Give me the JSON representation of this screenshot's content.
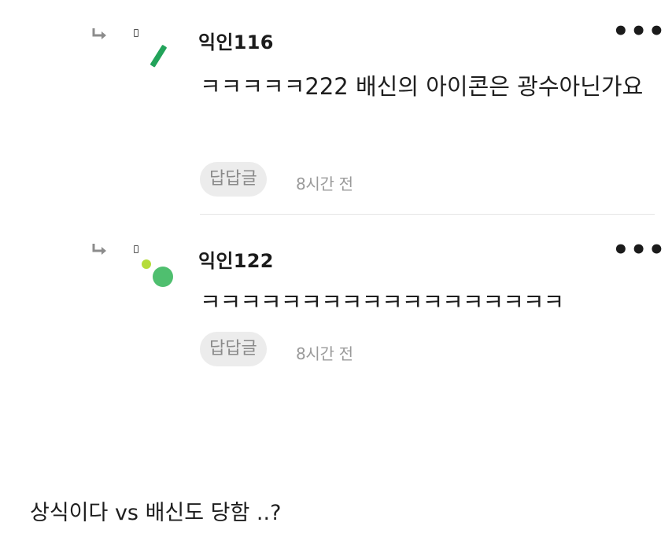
{
  "comments": [
    {
      "author": "익인116",
      "text": "ㅋㅋㅋㅋㅋ222 배신의 아이콘은 광수아닌가요",
      "reply_label": "답답글",
      "time": "8시간 전",
      "avatar_icon": "green-dash-icon",
      "more_label": "•••"
    },
    {
      "author": "익인122",
      "text": "ㅋㅋㅋㅋㅋㅋㅋㅋㅋㅋㅋㅋㅋㅋㅋㅋㅋㅋ",
      "reply_label": "답답글",
      "time": "8시간 전",
      "avatar_icon": "green-dots-icon",
      "more_label": "•••"
    }
  ],
  "footer": {
    "text": "상식이다 vs 배신도 당함 ..?"
  },
  "colors": {
    "accent_green": "#22a35a",
    "dot_green": "#4fbf6f",
    "dot_lime": "#b5dc3a",
    "chip_bg": "#ececec"
  }
}
